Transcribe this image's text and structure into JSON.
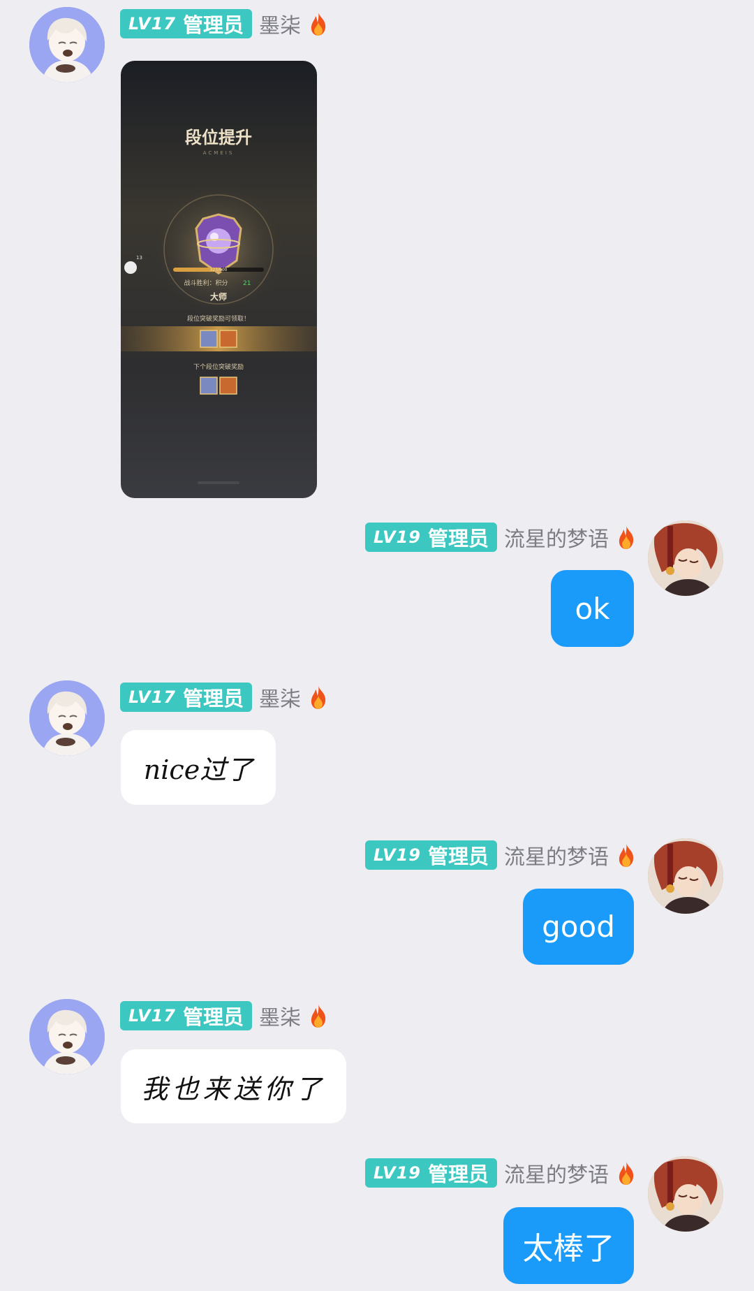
{
  "users": {
    "left": {
      "level": "LV17",
      "role": "管理员",
      "name": "墨柒"
    },
    "right": {
      "level": "LV19",
      "role": "管理员",
      "name": "流星的梦语"
    }
  },
  "image_message": {
    "title": "段位提升",
    "subtitle": "ACMEIS",
    "rank_name": "大师",
    "progress_text": "323/600",
    "progress": 0.54,
    "battle_result": "战斗胜利：积分",
    "points_gain": "21",
    "reward_claim_text": "段位突破奖励可领取！",
    "next_reward_text": "下个段位突破奖励",
    "side_badge": "13"
  },
  "messages": [
    {
      "side": "right",
      "text": "ok"
    },
    {
      "side": "left",
      "text": "nice过了"
    },
    {
      "side": "right",
      "text": "good"
    },
    {
      "side": "left",
      "text": "我也来送你了"
    },
    {
      "side": "right",
      "text": "太棒了"
    }
  ],
  "colors": {
    "background": "#EEEEF2",
    "badge": "#3CC7C1",
    "outgoing_bubble": "#1A9BFA",
    "incoming_bubble": "#FFFFFF",
    "nickname": "#7C7C84"
  },
  "icons": {
    "flame": "flame-icon"
  }
}
